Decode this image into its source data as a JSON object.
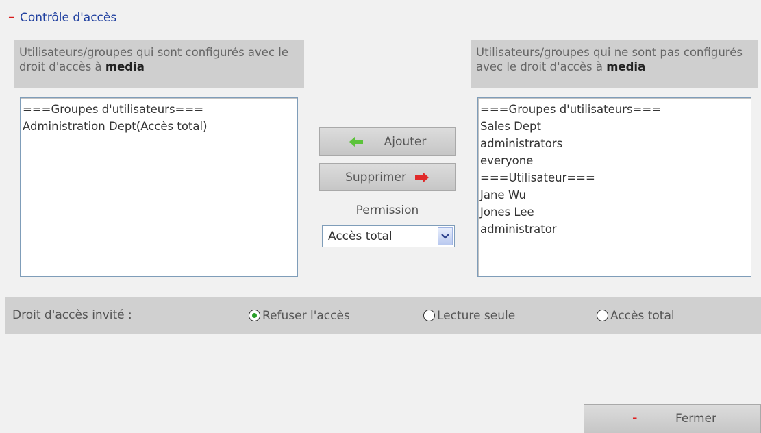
{
  "section": {
    "title": "Contrôle d'accès",
    "collapse_icon": "minus-icon"
  },
  "left_panel": {
    "header_text": "Utilisateurs/groupes qui sont configurés avec le droit d'accès à",
    "share_name": "media",
    "items": [
      "===Groupes d'utilisateurs===",
      "Administration Dept(Accès total)"
    ]
  },
  "right_panel": {
    "header_text": "Utilisateurs/groupes qui ne sont pas configurés avec le droit d'accès à",
    "share_name": "media",
    "items": [
      "===Groupes d'utilisateurs===",
      "Sales Dept",
      "administrators",
      "everyone",
      "===Utilisateur===",
      "Jane Wu",
      "Jones Lee",
      "administrator"
    ]
  },
  "actions": {
    "add_label": "Ajouter",
    "remove_label": "Supprimer",
    "add_icon": "arrow-left-icon",
    "remove_icon": "arrow-right-icon"
  },
  "permission": {
    "label": "Permission",
    "selected": "Accès total"
  },
  "guest": {
    "label": "Droit d'accès invité :",
    "options": [
      "Refuser l'accès",
      "Lecture seule",
      "Accès total"
    ],
    "selected_index": 0
  },
  "footer": {
    "close_label": "Fermer"
  },
  "colors": {
    "accent_red": "#d81b1b",
    "arrow_green": "#5cc33a",
    "title_blue": "#1f3f9f",
    "radio_green": "#2aa02a"
  }
}
